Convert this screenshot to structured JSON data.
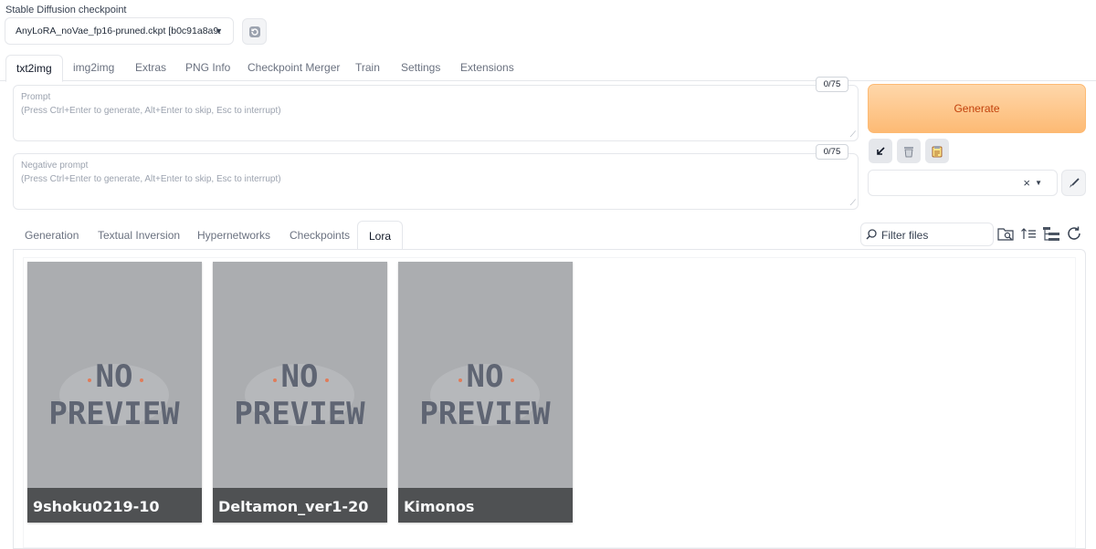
{
  "checkpoint": {
    "label": "Stable Diffusion checkpoint",
    "value": "AnyLoRA_noVae_fp16-pruned.ckpt [b0c91a8a9."
  },
  "tabs": [
    "txt2img",
    "img2img",
    "Extras",
    "PNG Info",
    "Checkpoint Merger",
    "Train",
    "Settings",
    "Extensions"
  ],
  "prompt": {
    "label": "Prompt",
    "placeholder": "(Press Ctrl+Enter to generate, Alt+Enter to skip, Esc to interrupt)",
    "counter": "0/75"
  },
  "negative_prompt": {
    "label": "Negative prompt",
    "placeholder": "(Press Ctrl+Enter to generate, Alt+Enter to skip, Esc to interrupt)",
    "counter": "0/75"
  },
  "generate_label": "Generate",
  "style_clear": "×",
  "subtabs": [
    "Generation",
    "Textual Inversion",
    "Hypernetworks",
    "Checkpoints",
    "Lora"
  ],
  "filter_placeholder": "Filter files",
  "cards": [
    {
      "name": "9shoku0219-10",
      "preview_text_1": "NO",
      "preview_text_2": "PREVIEW"
    },
    {
      "name": "Deltamon_ver1-20",
      "preview_text_1": "NO",
      "preview_text_2": "PREVIEW"
    },
    {
      "name": "Kimonos",
      "preview_text_1": "NO",
      "preview_text_2": "PREVIEW"
    }
  ],
  "colors": {
    "generate_bg": "#fdba74",
    "generate_text": "#c2410c",
    "card_bg": "#abadb0",
    "card_label_bg": "#4f5153",
    "no_preview_text": "#6b7280"
  },
  "icons": [
    "refresh-icon",
    "caret-down-icon",
    "arrow-down-left-icon",
    "trash-icon",
    "clipboard-icon",
    "paintbrush-icon",
    "search-icon",
    "folder-search-icon",
    "sort-icon",
    "tree-view-icon",
    "reload-icon",
    "resize-grip-icon"
  ]
}
